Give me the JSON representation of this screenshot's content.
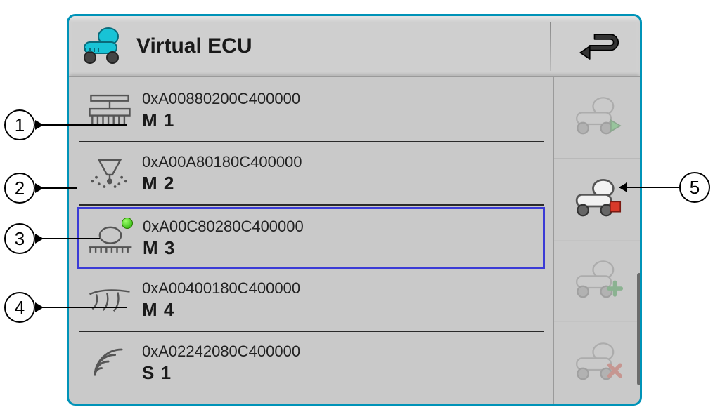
{
  "header": {
    "title": "Virtual ECU"
  },
  "rows": [
    {
      "hex": "0xA00880200C400000",
      "name": "M 1",
      "icon": "seeder"
    },
    {
      "hex": "0xA00A80180C400000",
      "name": "M 2",
      "icon": "spreader"
    },
    {
      "hex": "0xA00C80280C400000",
      "name": "M 3",
      "icon": "sprayer",
      "selected": true,
      "active": true
    },
    {
      "hex": "0xA00400180C400000",
      "name": "M 4",
      "icon": "plough"
    },
    {
      "hex": "0xA02242080C400000",
      "name": "S 1",
      "icon": "sensor"
    }
  ],
  "sidebar": {
    "buttons": [
      "play",
      "stop",
      "add",
      "delete"
    ]
  },
  "callouts": {
    "1": "1",
    "2": "2",
    "3": "3",
    "4": "4",
    "5": "5"
  }
}
